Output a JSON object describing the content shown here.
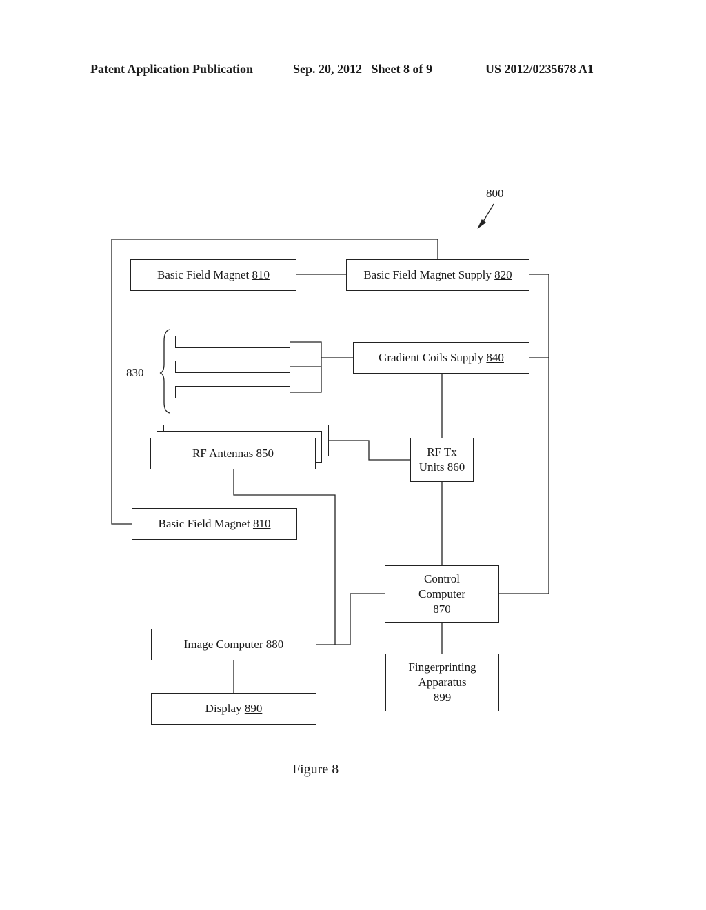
{
  "header": {
    "publication": "Patent Application Publication",
    "date_sheet": "Sep. 20, 2012   Sheet 8 of 9",
    "patent_number": "US 2012/0235678 A1"
  },
  "figure": {
    "reference": "800",
    "caption": "Figure 8",
    "group_label": "830"
  },
  "blocks": {
    "magnet_top": {
      "text": "Basic Field Magnet ",
      "ref": "810"
    },
    "magnet_supply": {
      "text": "Basic Field Magnet Supply ",
      "ref": "820"
    },
    "gradient_supply": {
      "text": "Gradient Coils Supply ",
      "ref": "840"
    },
    "rf_antennas": {
      "text": "RF Antennas ",
      "ref": "850"
    },
    "rf_tx": {
      "line1": "RF Tx",
      "line2": "Units ",
      "ref": "860"
    },
    "magnet_bottom": {
      "text": "Basic Field Magnet ",
      "ref": "810"
    },
    "control_computer": {
      "line1": "Control",
      "line2": "Computer",
      "ref": "870"
    },
    "image_computer": {
      "text": "Image Computer ",
      "ref": "880"
    },
    "display": {
      "text": "Display ",
      "ref": "890"
    },
    "fingerprinting": {
      "line1": "Fingerprinting",
      "line2": "Apparatus",
      "ref": "899"
    }
  }
}
